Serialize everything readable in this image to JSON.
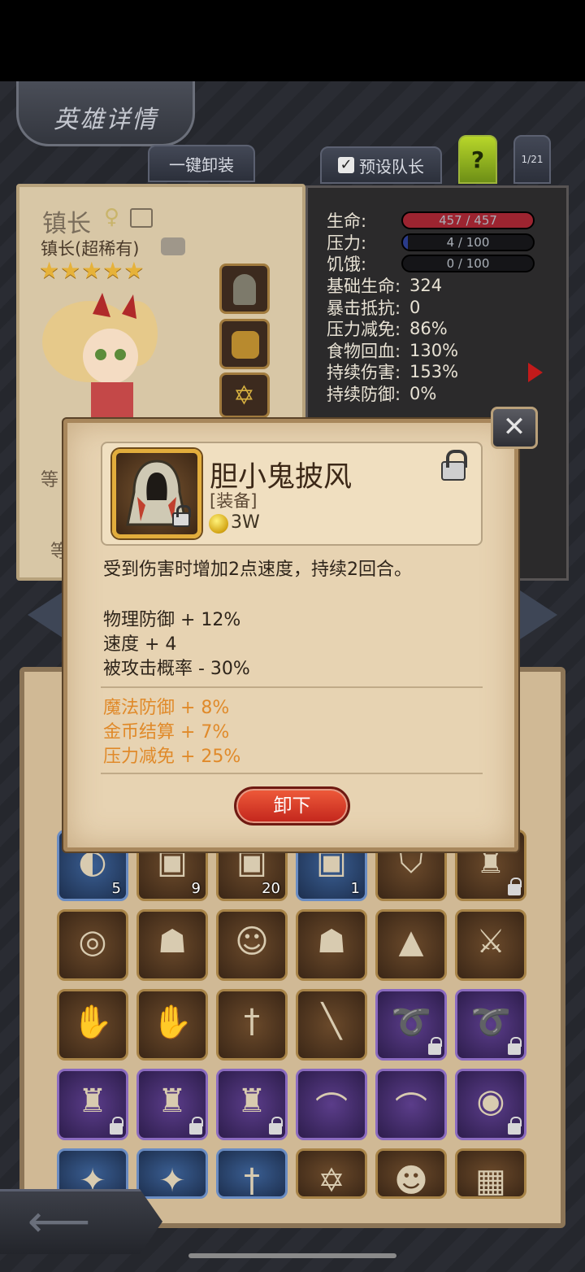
{
  "header": {
    "title": "英雄详情",
    "unequip_all": "一键卸装",
    "preset_leader": "预设队长",
    "help": "?",
    "page": "1/21"
  },
  "hero": {
    "name": "镇长",
    "class": "镇长(超稀有)",
    "stars": "★★★★★",
    "left_partial_1": "等",
    "left_partial_2": "等"
  },
  "stats": {
    "hp_label": "生命:",
    "hp_value": "457 / 457",
    "hp_fill": 1.0,
    "stress_label": "压力:",
    "stress_value": "4 / 100",
    "stress_fill": 0.04,
    "hunger_label": "饥饿:",
    "hunger_value": "0 / 100",
    "hunger_fill": 0.0,
    "rows": [
      {
        "label": "基础生命:",
        "value": "324"
      },
      {
        "label": "暴击抵抗:",
        "value": "0"
      },
      {
        "label": "压力减免:",
        "value": "86%"
      },
      {
        "label": "食物回血:",
        "value": "130%"
      },
      {
        "label": "持续伤害:",
        "value": "153%"
      },
      {
        "label": "持续防御:",
        "value": "0%"
      }
    ],
    "colors": {
      "hp": "#9c2430",
      "stress": "#2a3b8a",
      "hunger": "#3a2a2a"
    }
  },
  "popup": {
    "item_name": "胆小鬼披风",
    "item_type": "[装备]",
    "price": "3W",
    "description": "受到伤害时增加2点速度，持续2回合。",
    "base_stats": [
      "物理防御 + 12%",
      "速度 + 4",
      "被攻击概率 - 30%"
    ],
    "bonus_stats": [
      "魔法防御 + 8%",
      "金币结算 + 7%",
      "压力减免 + 25%"
    ],
    "unequip_label": "卸下",
    "close_icon": "crossed-swords-icon"
  },
  "inventory": {
    "counts": [
      "5",
      "9",
      "20",
      "1"
    ]
  }
}
